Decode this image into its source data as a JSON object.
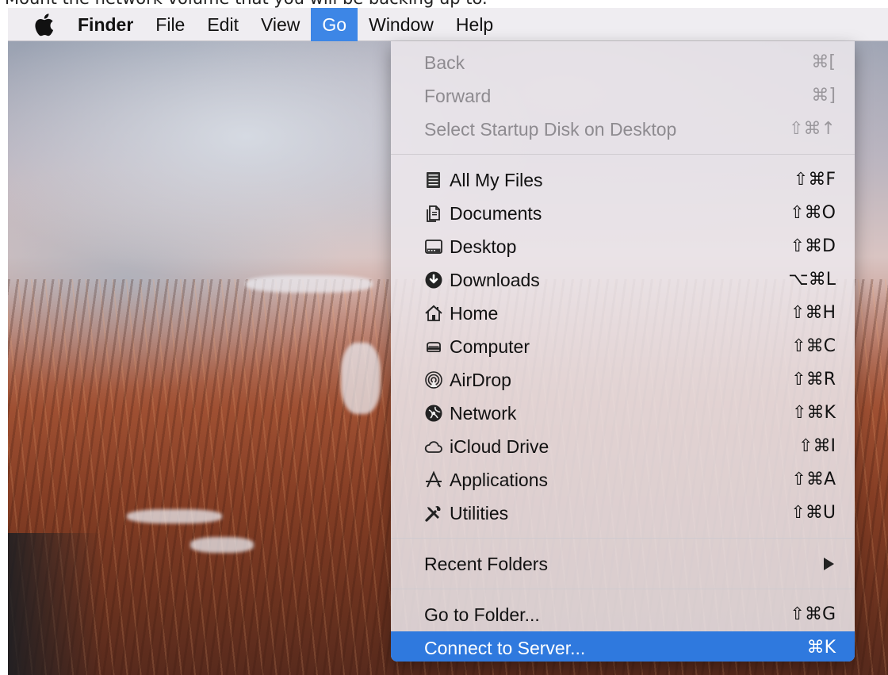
{
  "caption": "Mount the network volume that you will be backing up to.",
  "menubar": {
    "apple_icon": "apple-logo-icon",
    "items": [
      "Finder",
      "File",
      "Edit",
      "View",
      "Go",
      "Window",
      "Help"
    ],
    "active": "Go"
  },
  "go_menu": {
    "history": [
      {
        "label": "Back",
        "shortcut": "⌘[",
        "enabled": false
      },
      {
        "label": "Forward",
        "shortcut": "⌘]",
        "enabled": false
      },
      {
        "label": "Select Startup Disk on Desktop",
        "shortcut": "⇧⌘↑",
        "enabled": false
      }
    ],
    "locations": [
      {
        "label": "All My Files",
        "shortcut": "⇧⌘F",
        "icon": "all-my-files-icon"
      },
      {
        "label": "Documents",
        "shortcut": "⇧⌘O",
        "icon": "documents-icon"
      },
      {
        "label": "Desktop",
        "shortcut": "⇧⌘D",
        "icon": "desktop-icon"
      },
      {
        "label": "Downloads",
        "shortcut": "⌥⌘L",
        "icon": "downloads-icon"
      },
      {
        "label": "Home",
        "shortcut": "⇧⌘H",
        "icon": "home-icon"
      },
      {
        "label": "Computer",
        "shortcut": "⇧⌘C",
        "icon": "computer-icon"
      },
      {
        "label": "AirDrop",
        "shortcut": "⇧⌘R",
        "icon": "airdrop-icon"
      },
      {
        "label": "Network",
        "shortcut": "⇧⌘K",
        "icon": "network-icon"
      },
      {
        "label": "iCloud Drive",
        "shortcut": "⇧⌘I",
        "icon": "icloud-icon"
      },
      {
        "label": "Applications",
        "shortcut": "⇧⌘A",
        "icon": "applications-icon"
      },
      {
        "label": "Utilities",
        "shortcut": "⇧⌘U",
        "icon": "utilities-icon"
      }
    ],
    "recent_folders": {
      "label": "Recent Folders",
      "icon": "submenu-arrow-icon"
    },
    "actions": [
      {
        "label": "Go to Folder...",
        "shortcut": "⇧⌘G"
      },
      {
        "label": "Connect to Server...",
        "shortcut": "⌘K",
        "highlighted": true
      }
    ]
  },
  "colors": {
    "highlight": "#2f79de",
    "active_menu": "#3d86e6",
    "disabled_text": "#8e8b90"
  }
}
